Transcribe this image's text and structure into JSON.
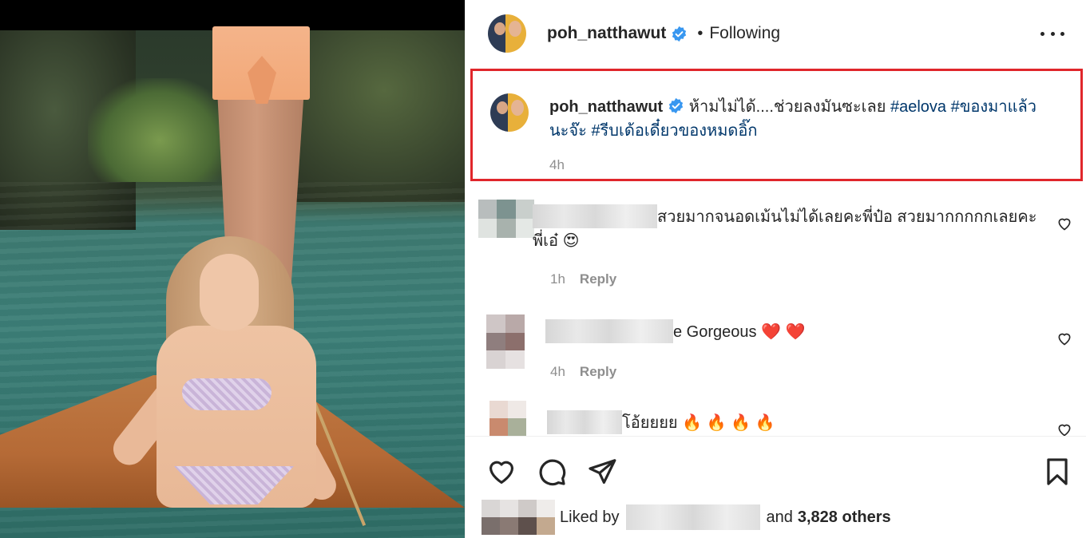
{
  "post": {
    "username": "poh_natthawut",
    "separator": "•",
    "follow_status": "Following"
  },
  "caption": {
    "username": "poh_natthawut",
    "text": "ห้ามไม่ได้....ช่วยลงมันซะเลย",
    "hashtags": [
      "#aelova",
      "#ของมาแล้วนะจ๊ะ",
      "#รีบเด้อเดี๋ยวของหมดอิ๊ก"
    ],
    "time": "4h"
  },
  "comments": [
    {
      "text": "สวยมากจนอดเม้นไม่ได้เลยคะพี่ป๋อ สวยมากกกกกเลยคะพี่เอ๋",
      "emoji": "😍",
      "time": "1h",
      "reply_label": "Reply"
    },
    {
      "text": "e Gorgeous",
      "emoji": "❤️ ❤️",
      "time": "4h",
      "reply_label": "Reply"
    },
    {
      "text": "โอ้ยยยย",
      "emoji": "🔥 🔥 🔥 🔥"
    }
  ],
  "likes": {
    "prefix": "Liked by",
    "and_word": "and",
    "others": "3,828 others"
  },
  "colors": {
    "caption_highlight_border": "#e0262b",
    "hashtag": "#00376b",
    "verified": "#3897f0",
    "muted": "#8e8e8e",
    "heart_emoji": "#ed4956"
  },
  "icons": [
    "verified-badge-icon",
    "more-options-icon",
    "heart-icon",
    "comment-icon",
    "share-icon",
    "save-icon"
  ]
}
